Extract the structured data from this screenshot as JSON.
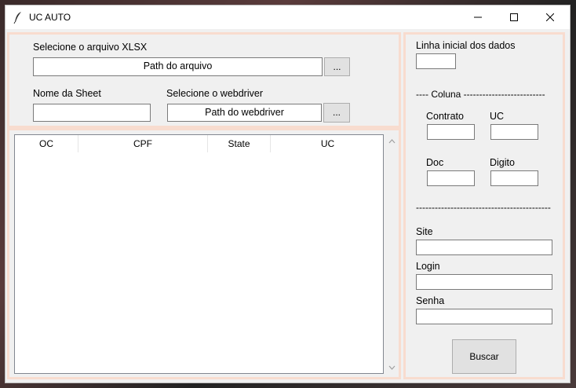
{
  "window": {
    "title": "UC AUTO"
  },
  "file_section": {
    "label": "Selecione o arquivo XLSX",
    "path_text": "Path do arquivo",
    "browse_label": "..."
  },
  "sheet_section": {
    "label": "Nome da Sheet",
    "value": ""
  },
  "webdriver_section": {
    "label": "Selecione o webdriver",
    "path_text": "Path do webdriver",
    "browse_label": "..."
  },
  "table": {
    "columns": [
      "OC",
      "CPF",
      "State",
      "UC"
    ]
  },
  "right_panel": {
    "start_line_label": "Linha inicial dos dados",
    "coluna_separator": "---- Coluna --------------------------",
    "contrato_label": "Contrato",
    "uc_label": "UC",
    "doc_label": "Doc",
    "digito_label": "Digito",
    "bottom_separator": "-------------------------------------------",
    "site_label": "Site",
    "login_label": "Login",
    "senha_label": "Senha",
    "search_button": "Buscar"
  }
}
